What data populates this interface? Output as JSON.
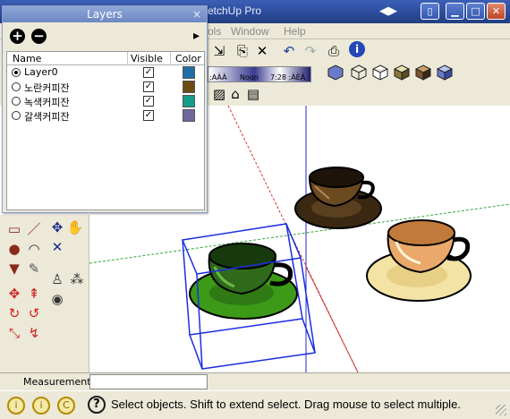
{
  "window": {
    "title": "etchUp Pro",
    "nav_arrows": "◀▶",
    "minimize": "▁",
    "maximize": "□",
    "close": "✕",
    "extra": "▯"
  },
  "menu": {
    "items": [
      "ols",
      "Window",
      "Help"
    ]
  },
  "toolbar": {
    "shadow_labels": [
      ";AÀÀ",
      "Noon",
      "7:28 ;ÀÈÀ"
    ],
    "icons": [
      "walk-icon",
      "paste-icon",
      "erase-icon",
      "undo-icon",
      "redo-icon",
      "print-icon",
      "info-icon"
    ]
  },
  "layers_dialog": {
    "title": "Layers",
    "close": "×",
    "add_label": "+",
    "remove_label": "−",
    "details_label": "▸",
    "columns": [
      "Name",
      "Visible",
      "Color"
    ],
    "rows": [
      {
        "name": "Layer0",
        "active": true,
        "visible": "✓",
        "color": "#1f6ea8"
      },
      {
        "name": "노란커피잔",
        "active": false,
        "visible": "✓",
        "color": "#6e4b12"
      },
      {
        "name": "녹색커피잔",
        "active": false,
        "visible": "✓",
        "color": "#159c8a"
      },
      {
        "name": "갈색커피잔",
        "active": false,
        "visible": "✓",
        "color": "#6f69a0"
      }
    ]
  },
  "measurements": {
    "label": "Measurements",
    "value": ""
  },
  "status": {
    "text": "Select objects. Shift to extend select. Drag mouse to select multiple.",
    "circle_icons": [
      "i",
      "i",
      "C"
    ],
    "help": "?"
  },
  "colors": {
    "axis_red": "#d23a3a",
    "axis_green": "#36a536",
    "axis_blue": "#2a2ad0",
    "selection": "#1c2ee0"
  }
}
